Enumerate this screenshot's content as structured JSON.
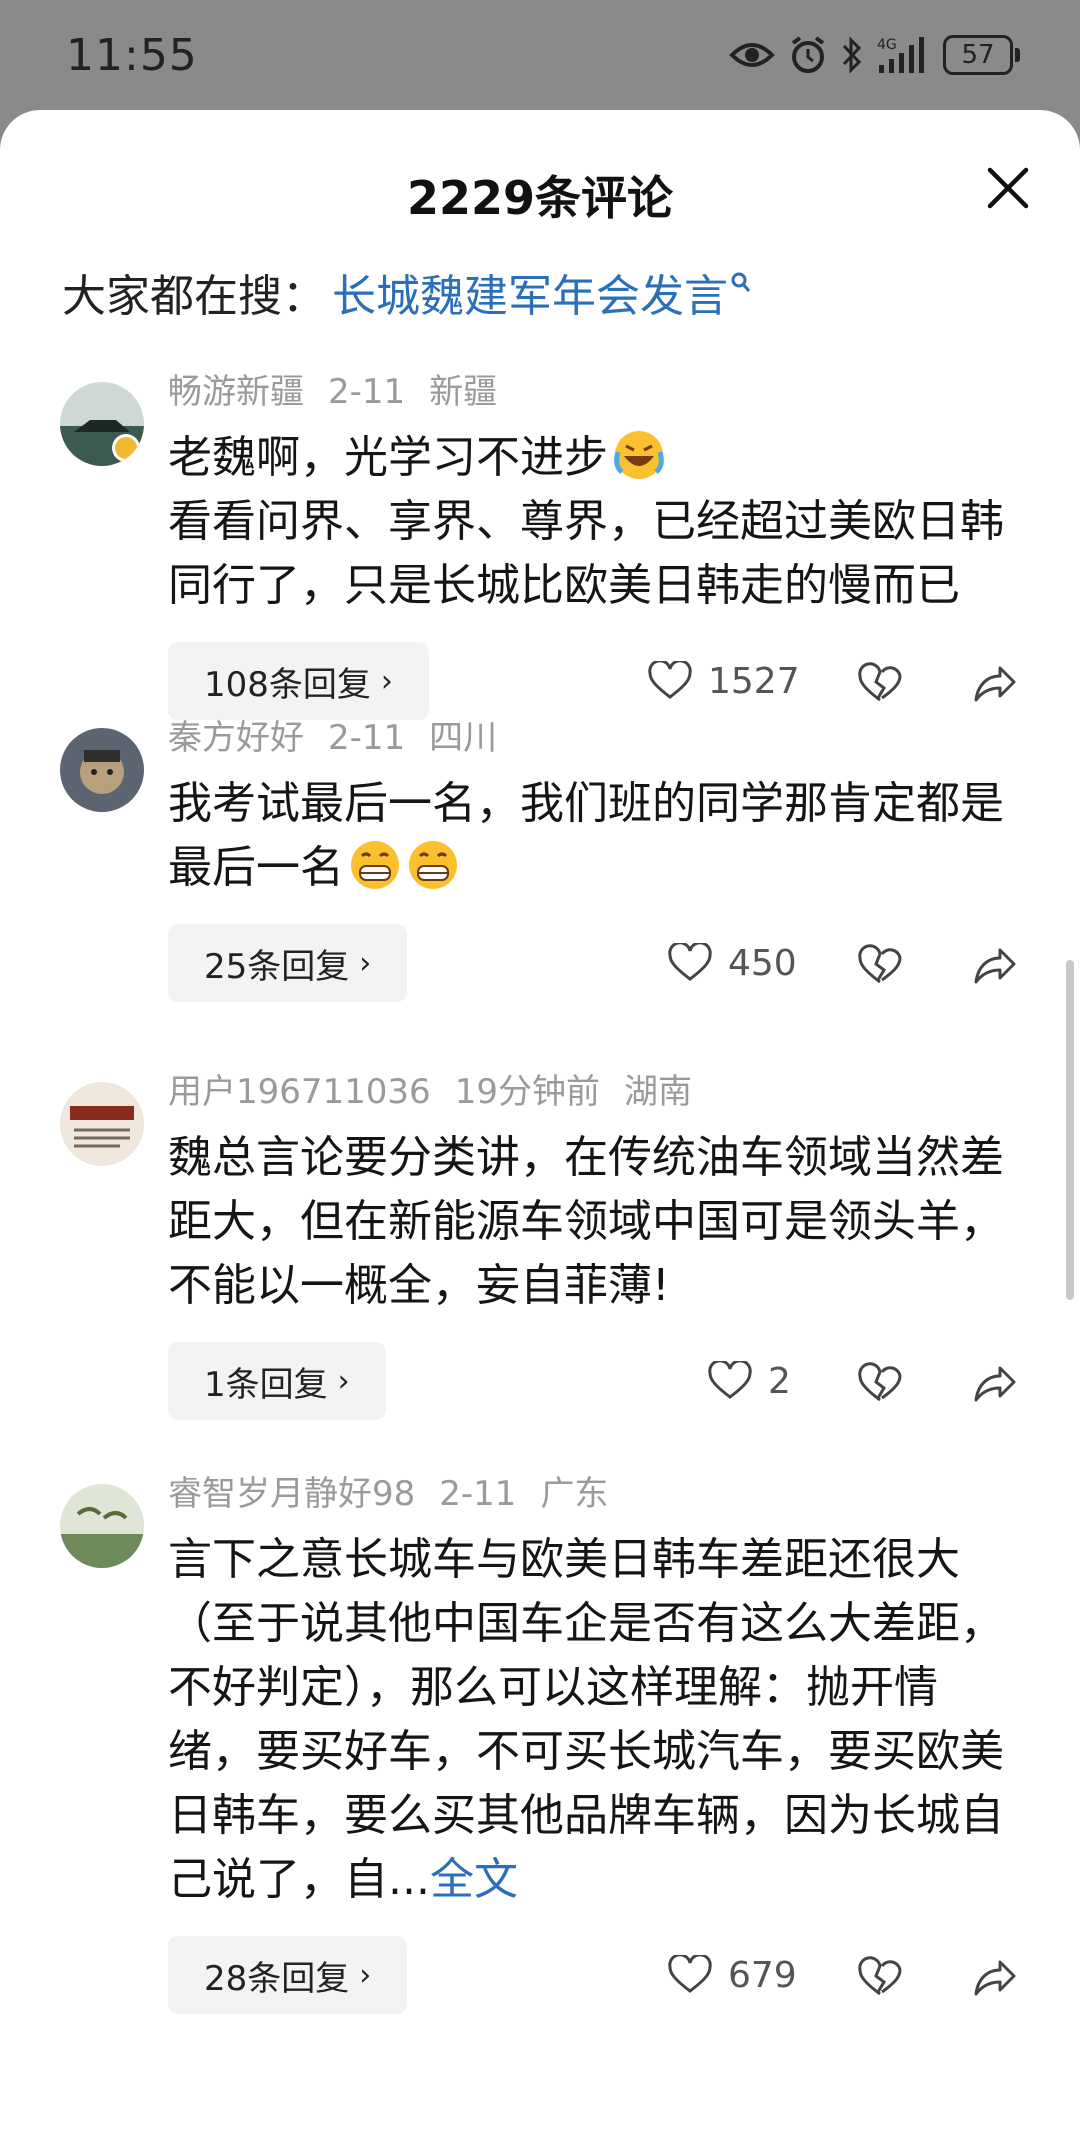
{
  "status": {
    "time": "11:55",
    "battery": "57"
  },
  "sheet": {
    "title": "2229条评论"
  },
  "trending": {
    "label": "大家都在搜：",
    "keyword": "长城魏建军年会发言"
  },
  "comments": [
    {
      "user": "畅游新疆",
      "date": "2-11",
      "region": "新疆",
      "lines": [
        "老魏啊，光学习不进步",
        "看看问界、享界、尊界，已经超过美欧日韩同行了，只是长城比欧美日韩走的慢而已"
      ],
      "replies": "108条回复",
      "likes": "1527"
    },
    {
      "user": "秦方好好",
      "date": "2-11",
      "region": "四川",
      "text": "我考试最后一名，我们班的同学那肯定都是最后一名",
      "replies": "25条回复",
      "likes": "450"
    },
    {
      "user": "用户196711036",
      "date": "19分钟前",
      "region": "湖南",
      "text": "魏总言论要分类讲，在传统油车领域当然差距大，但在新能源车领域中国可是领头羊，不能以一概全，妄自菲薄!",
      "replies": "1条回复",
      "likes": "2"
    },
    {
      "user": "睿智岁月静好98",
      "date": "2-11",
      "region": "广东",
      "text": "言下之意长城车与欧美日韩车差距还很大（至于说其他中国车企是否有这么大差距，不好判定），那么可以这样理解：抛开情绪，要买好车，不可买长城汽车，要买欧美日韩车，要么买其他品牌车辆，因为长城自己说了，自...",
      "more": "全文",
      "replies": "28条回复",
      "likes": "679"
    }
  ]
}
